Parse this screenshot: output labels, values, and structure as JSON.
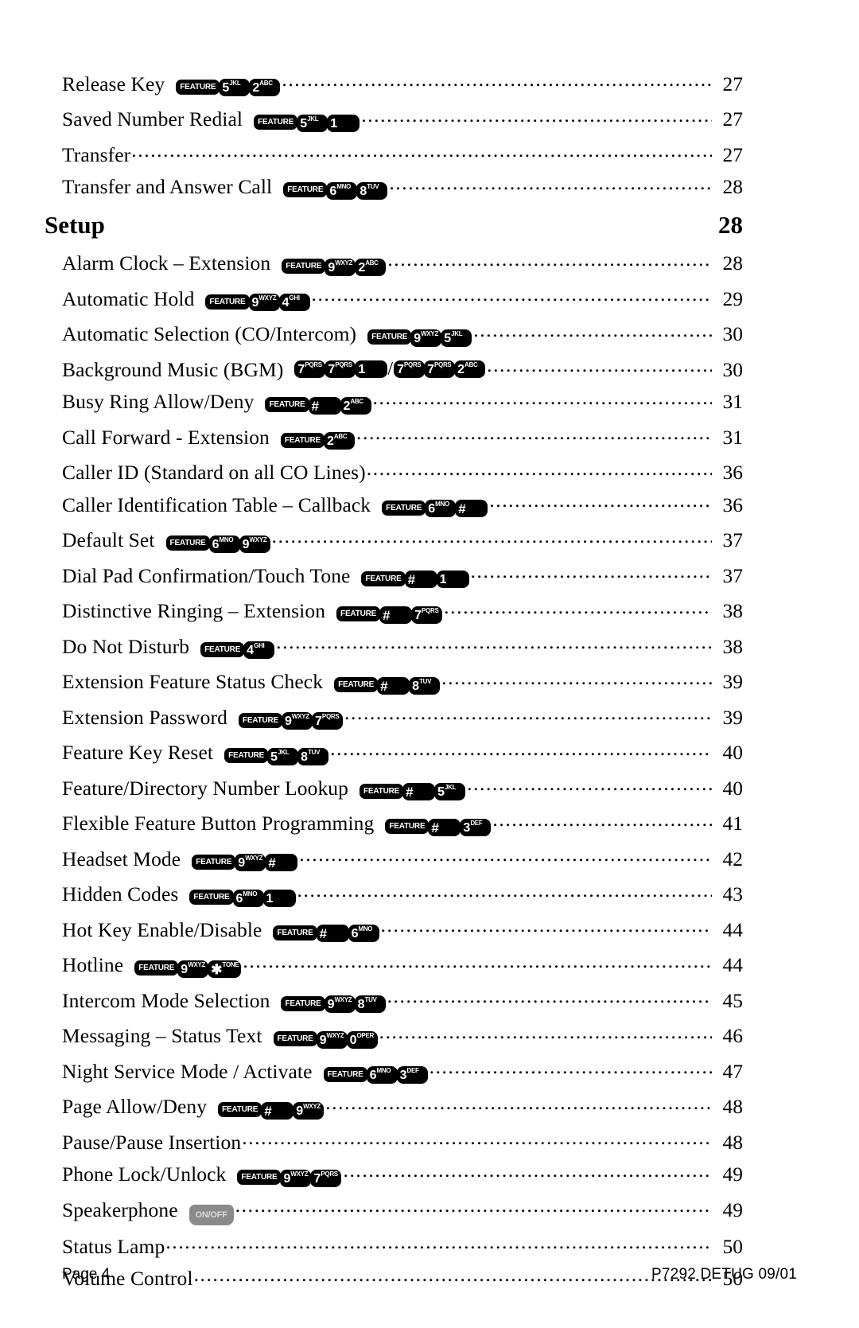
{
  "document": {
    "page_label": "Page 4",
    "doc_code": "P7292 DETUG 09/01"
  },
  "toc": {
    "entries": [
      {
        "label": "Release Key",
        "page": "27",
        "keys": [
          {
            "type": "feature",
            "text": "FEATURE"
          },
          {
            "type": "digit",
            "num": "5",
            "sub": "JKL"
          },
          {
            "type": "digit",
            "num": "2",
            "sub": "ABC"
          }
        ]
      },
      {
        "label": "Saved Number Redial",
        "page": "27",
        "keys": [
          {
            "type": "feature",
            "text": "FEATURE"
          },
          {
            "type": "digit",
            "num": "5",
            "sub": "JKL"
          },
          {
            "type": "digit",
            "num": "1",
            "sub": ""
          }
        ]
      },
      {
        "label": "Transfer",
        "page": "27",
        "keys": []
      },
      {
        "label": "Transfer and Answer Call",
        "page": "28",
        "keys": [
          {
            "type": "feature",
            "text": "FEATURE"
          },
          {
            "type": "digit",
            "num": "6",
            "sub": "MNO"
          },
          {
            "type": "digit",
            "num": "8",
            "sub": "TUV"
          }
        ]
      }
    ]
  },
  "section": {
    "title": "Setup",
    "page": "28"
  },
  "setup": {
    "entries": [
      {
        "label": "Alarm Clock – Extension",
        "page": "28",
        "keys": [
          {
            "type": "feature",
            "text": "FEATURE"
          },
          {
            "type": "digit",
            "num": "9",
            "sub": "WXYZ"
          },
          {
            "type": "digit",
            "num": "2",
            "sub": "ABC"
          }
        ]
      },
      {
        "label": "Automatic Hold",
        "page": "29",
        "keys": [
          {
            "type": "feature",
            "text": "FEATURE"
          },
          {
            "type": "digit",
            "num": "9",
            "sub": "WXYZ"
          },
          {
            "type": "digit",
            "num": "4",
            "sub": "GHI"
          }
        ]
      },
      {
        "label": "Automatic Selection (CO/Intercom)",
        "page": "30",
        "keys": [
          {
            "type": "feature",
            "text": "FEATURE"
          },
          {
            "type": "digit",
            "num": "9",
            "sub": "WXYZ"
          },
          {
            "type": "digit",
            "num": "5",
            "sub": "JKL"
          }
        ]
      },
      {
        "label": "Background Music (BGM)",
        "page": "30",
        "keys": [
          {
            "type": "digit",
            "num": "7",
            "sub": "PQRS"
          },
          {
            "type": "digit",
            "num": "7",
            "sub": "PQRS"
          },
          {
            "type": "digit",
            "num": "1",
            "sub": ""
          },
          {
            "type": "sep",
            "text": "/"
          },
          {
            "type": "digit",
            "num": "7",
            "sub": "PQRS"
          },
          {
            "type": "digit",
            "num": "7",
            "sub": "PQRS"
          },
          {
            "type": "digit",
            "num": "2",
            "sub": "ABC"
          }
        ]
      },
      {
        "label": "Busy Ring Allow/Deny",
        "page": "31",
        "keys": [
          {
            "type": "feature",
            "text": "FEATURE"
          },
          {
            "type": "digit",
            "num": "#",
            "sub": ""
          },
          {
            "type": "digit",
            "num": "2",
            "sub": "ABC"
          }
        ]
      },
      {
        "label": "Call Forward - Extension",
        "page": "31",
        "keys": [
          {
            "type": "feature",
            "text": "FEATURE"
          },
          {
            "type": "digit",
            "num": "2",
            "sub": "ABC"
          }
        ]
      },
      {
        "label": "Caller ID (Standard on all CO Lines)",
        "page": "36",
        "keys": []
      },
      {
        "label": "Caller Identification Table – Callback",
        "page": "36",
        "keys": [
          {
            "type": "feature",
            "text": "FEATURE"
          },
          {
            "type": "digit",
            "num": "6",
            "sub": "MNO"
          },
          {
            "type": "digit",
            "num": "#",
            "sub": ""
          }
        ]
      },
      {
        "label": "Default Set",
        "page": "37",
        "keys": [
          {
            "type": "feature",
            "text": "FEATURE"
          },
          {
            "type": "digit",
            "num": "6",
            "sub": "MNO"
          },
          {
            "type": "digit",
            "num": "9",
            "sub": "WXYZ"
          }
        ]
      },
      {
        "label": "Dial Pad Confirmation/Touch Tone",
        "page": "37",
        "keys": [
          {
            "type": "feature",
            "text": "FEATURE"
          },
          {
            "type": "digit",
            "num": "#",
            "sub": ""
          },
          {
            "type": "digit",
            "num": "1",
            "sub": ""
          }
        ]
      },
      {
        "label": "Distinctive Ringing – Extension",
        "page": "38",
        "keys": [
          {
            "type": "feature",
            "text": "FEATURE"
          },
          {
            "type": "digit",
            "num": "#",
            "sub": ""
          },
          {
            "type": "digit",
            "num": "7",
            "sub": "PQRS"
          }
        ]
      },
      {
        "label": "Do Not Disturb",
        "page": "38",
        "keys": [
          {
            "type": "feature",
            "text": "FEATURE"
          },
          {
            "type": "digit",
            "num": "4",
            "sub": "GHI"
          }
        ]
      },
      {
        "label": "Extension Feature Status Check",
        "page": "39",
        "keys": [
          {
            "type": "feature",
            "text": "FEATURE"
          },
          {
            "type": "digit",
            "num": "#",
            "sub": ""
          },
          {
            "type": "digit",
            "num": "8",
            "sub": "TUV"
          }
        ]
      },
      {
        "label": "Extension Password",
        "page": "39",
        "keys": [
          {
            "type": "feature",
            "text": "FEATURE"
          },
          {
            "type": "digit",
            "num": "9",
            "sub": "WXYZ"
          },
          {
            "type": "digit",
            "num": "7",
            "sub": "PQRS"
          }
        ]
      },
      {
        "label": "Feature Key Reset",
        "page": "40",
        "keys": [
          {
            "type": "feature",
            "text": "FEATURE"
          },
          {
            "type": "digit",
            "num": "5",
            "sub": "JKL"
          },
          {
            "type": "digit",
            "num": "8",
            "sub": "TUV"
          }
        ]
      },
      {
        "label": "Feature/Directory Number Lookup",
        "page": "40",
        "keys": [
          {
            "type": "feature",
            "text": "FEATURE"
          },
          {
            "type": "digit",
            "num": "#",
            "sub": ""
          },
          {
            "type": "digit",
            "num": "5",
            "sub": "JKL"
          }
        ]
      },
      {
        "label": "Flexible Feature Button Programming",
        "page": "41",
        "keys": [
          {
            "type": "feature",
            "text": "FEATURE"
          },
          {
            "type": "digit",
            "num": "#",
            "sub": ""
          },
          {
            "type": "digit",
            "num": "3",
            "sub": "DEF"
          }
        ]
      },
      {
        "label": "Headset Mode",
        "page": "42",
        "keys": [
          {
            "type": "feature",
            "text": "FEATURE"
          },
          {
            "type": "digit",
            "num": "9",
            "sub": "WXYZ"
          },
          {
            "type": "digit",
            "num": "#",
            "sub": ""
          }
        ]
      },
      {
        "label": "Hidden Codes",
        "page": "43",
        "keys": [
          {
            "type": "feature",
            "text": "FEATURE"
          },
          {
            "type": "digit",
            "num": "6",
            "sub": "MNO"
          },
          {
            "type": "digit",
            "num": "1",
            "sub": ""
          }
        ]
      },
      {
        "label": "Hot Key Enable/Disable",
        "page": "44",
        "keys": [
          {
            "type": "feature",
            "text": "FEATURE"
          },
          {
            "type": "digit",
            "num": "#",
            "sub": ""
          },
          {
            "type": "digit",
            "num": "6",
            "sub": "MNO"
          }
        ]
      },
      {
        "label": "Hotline",
        "page": "44",
        "keys": [
          {
            "type": "feature",
            "text": "FEATURE"
          },
          {
            "type": "digit",
            "num": "9",
            "sub": "WXYZ"
          },
          {
            "type": "digit",
            "num": "✱",
            "sub": "TONE"
          }
        ]
      },
      {
        "label": "Intercom Mode Selection",
        "page": "45",
        "keys": [
          {
            "type": "feature",
            "text": "FEATURE"
          },
          {
            "type": "digit",
            "num": "9",
            "sub": "WXYZ"
          },
          {
            "type": "digit",
            "num": "8",
            "sub": "TUV"
          }
        ]
      },
      {
        "label": "Messaging – Status Text",
        "page": "46",
        "keys": [
          {
            "type": "feature",
            "text": "FEATURE"
          },
          {
            "type": "digit",
            "num": "9",
            "sub": "WXYZ"
          },
          {
            "type": "digit",
            "num": "0",
            "sub": "OPER"
          }
        ]
      },
      {
        "label": "Night Service Mode / Activate",
        "page": "47",
        "keys": [
          {
            "type": "feature",
            "text": "FEATURE"
          },
          {
            "type": "digit",
            "num": "6",
            "sub": "MNO"
          },
          {
            "type": "digit",
            "num": "3",
            "sub": "DEF"
          }
        ]
      },
      {
        "label": "Page Allow/Deny",
        "page": "48",
        "keys": [
          {
            "type": "feature",
            "text": "FEATURE"
          },
          {
            "type": "digit",
            "num": "#",
            "sub": ""
          },
          {
            "type": "digit",
            "num": "9",
            "sub": "WXYZ"
          }
        ]
      },
      {
        "label": "Pause/Pause Insertion",
        "page": "48",
        "keys": []
      },
      {
        "label": "Phone Lock/Unlock",
        "page": "49",
        "keys": [
          {
            "type": "feature",
            "text": "FEATURE"
          },
          {
            "type": "digit",
            "num": "9",
            "sub": "WXYZ"
          },
          {
            "type": "digit",
            "num": "7",
            "sub": "PQRS"
          }
        ]
      },
      {
        "label": "Speakerphone",
        "page": "49",
        "keys": [
          {
            "type": "onoff",
            "text": "ON/OFF"
          }
        ]
      },
      {
        "label": "Status Lamp",
        "page": "50",
        "keys": []
      },
      {
        "label": "Volume Control",
        "page": "50",
        "keys": []
      }
    ]
  }
}
